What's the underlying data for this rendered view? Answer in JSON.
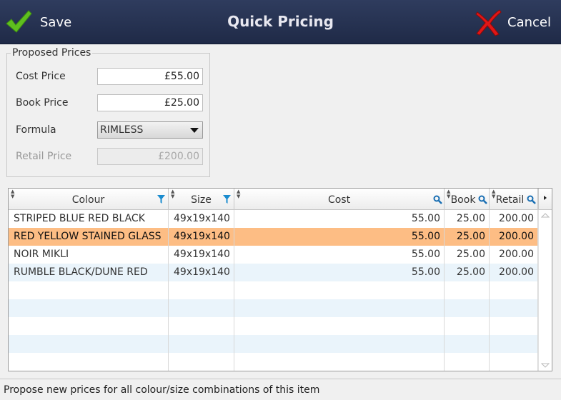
{
  "header": {
    "title": "Quick Pricing",
    "save_label": "Save",
    "cancel_label": "Cancel",
    "save_icon": "checkmark-icon",
    "cancel_icon": "x-cross-icon",
    "save_icon_color": "#5fbf1f",
    "cancel_icon_color": "#e01616"
  },
  "proposed": {
    "legend": "Proposed Prices",
    "cost_label": "Cost Price",
    "cost_value": "£55.00",
    "book_label": "Book Price",
    "book_value": "£25.00",
    "formula_label": "Formula",
    "formula_value": "RIMLESS",
    "retail_label": "Retail Price",
    "retail_value": "£200.00"
  },
  "grid": {
    "columns": [
      "Colour",
      "Size",
      "Cost",
      "Book",
      "Retail"
    ],
    "rows": [
      {
        "colour": "STRIPED BLUE RED BLACK",
        "size": "49x19x140",
        "cost": "55.00",
        "book": "25.00",
        "retail": "200.00"
      },
      {
        "colour": "RED YELLOW STAINED GLASS",
        "size": "49x19x140",
        "cost": "55.00",
        "book": "25.00",
        "retail": "200.00"
      },
      {
        "colour": "NOIR MIKLI",
        "size": "49x19x140",
        "cost": "55.00",
        "book": "25.00",
        "retail": "200.00"
      },
      {
        "colour": "RUMBLE BLACK/DUNE RED",
        "size": "49x19x140",
        "cost": "55.00",
        "book": "25.00",
        "retail": "200.00"
      }
    ],
    "selected_row_color": "#fdbd84",
    "alt_row_color": "#eaf4fb"
  },
  "status": {
    "text": "Propose new prices for all colour/size combinations of this item"
  }
}
